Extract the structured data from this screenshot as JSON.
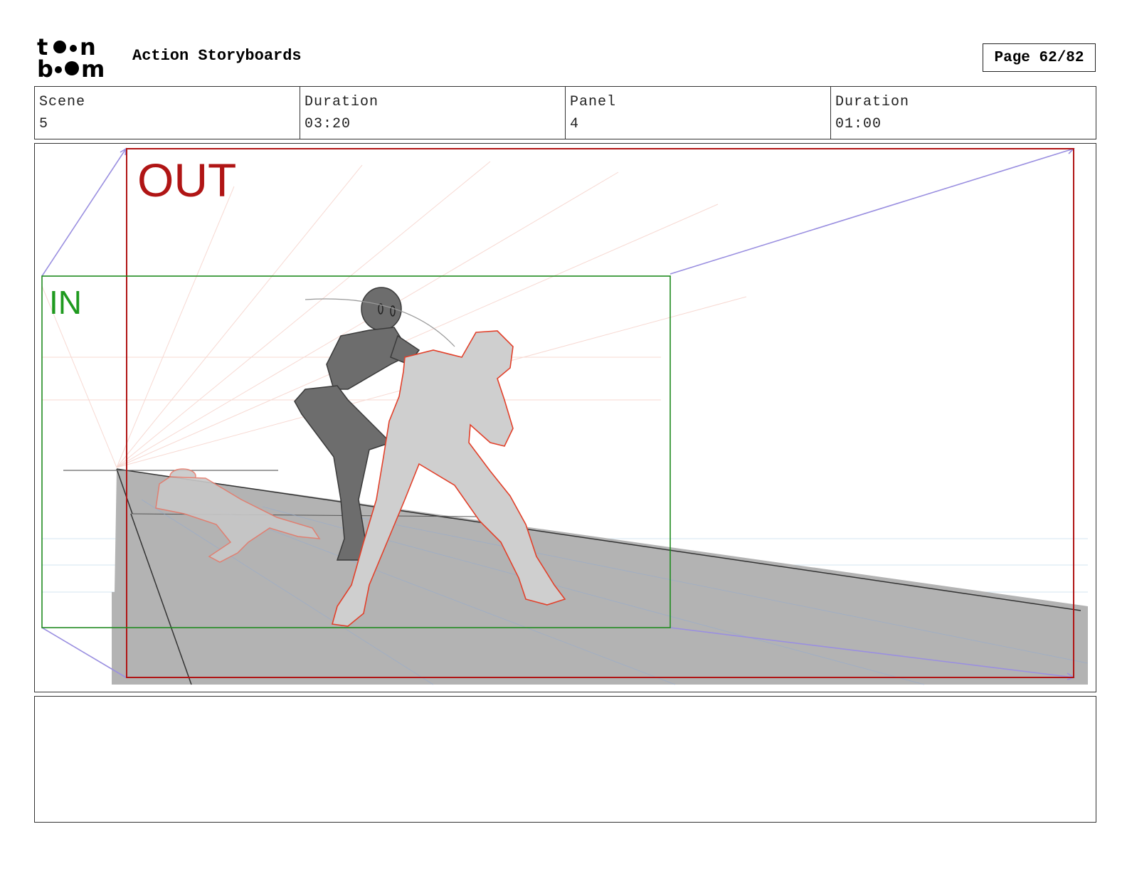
{
  "header": {
    "logo_text": [
      "to",
      "n",
      "b",
      "m"
    ],
    "title": "Action Storyboards",
    "page": "Page 62/82"
  },
  "info": [
    {
      "label": "Scene",
      "value": "5"
    },
    {
      "label": "Duration",
      "value": "03:20"
    },
    {
      "label": "Panel",
      "value": "4"
    },
    {
      "label": "Duration",
      "value": "01:00"
    }
  ],
  "panel": {
    "out_label": "OUT",
    "in_label": "IN",
    "colors": {
      "out_frame": "#b01515",
      "in_frame": "#1f8a1f",
      "camera_move": "#9a8fe0",
      "floor": "#b3b3b3",
      "figure_dark": "#6a6a6a",
      "figure_light": "#cfcfcf",
      "figure_outline": "#e2402a"
    }
  },
  "notes": {
    "text": ""
  }
}
